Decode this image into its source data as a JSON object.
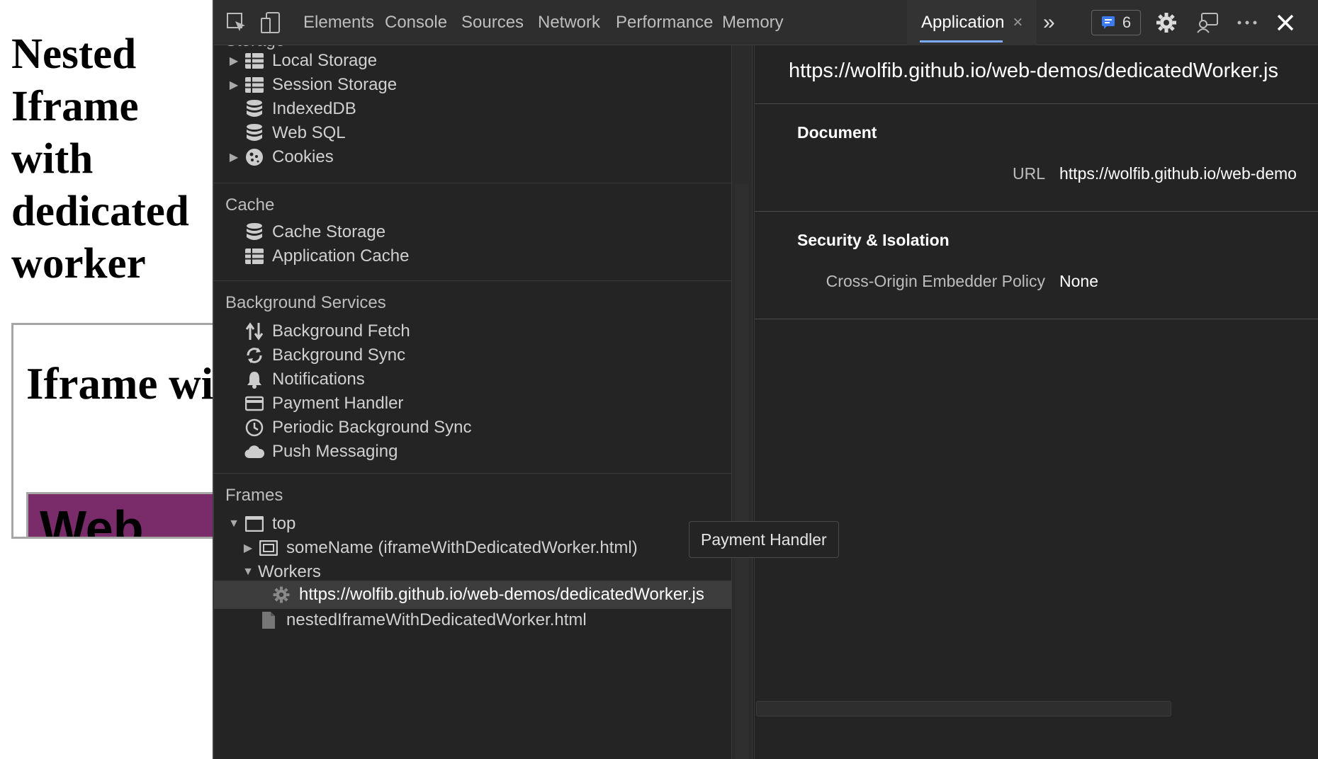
{
  "page": {
    "heading": "Nested Iframe with dedicated worker",
    "iframe_heading": "Iframe with dedicated",
    "inner_frame_text": "Web"
  },
  "toolbar": {
    "tabs": [
      "Elements",
      "Console",
      "Sources",
      "Network",
      "Performance",
      "Memory"
    ],
    "active_tab": "Application",
    "close_tab_glyph": "×",
    "more_tabs_glyph": "»",
    "issues_count": "6"
  },
  "sidebar": {
    "storage_items": [
      {
        "label": "Local Storage",
        "icon": "grid-icon",
        "expandable": true
      },
      {
        "label": "Session Storage",
        "icon": "grid-icon",
        "expandable": true
      },
      {
        "label": "IndexedDB",
        "icon": "database-icon",
        "expandable": false
      },
      {
        "label": "Web SQL",
        "icon": "database-icon",
        "expandable": false
      },
      {
        "label": "Cookies",
        "icon": "cookie-icon",
        "expandable": true
      }
    ],
    "cache_title": "Cache",
    "cache_items": [
      {
        "label": "Cache Storage",
        "icon": "database-icon"
      },
      {
        "label": "Application Cache",
        "icon": "grid-icon"
      }
    ],
    "background_title": "Background Services",
    "background_items": [
      {
        "label": "Background Fetch",
        "icon": "up-down-arrows-icon"
      },
      {
        "label": "Background Sync",
        "icon": "sync-icon"
      },
      {
        "label": "Notifications",
        "icon": "bell-icon"
      },
      {
        "label": "Payment Handler",
        "icon": "card-icon"
      },
      {
        "label": "Periodic Background Sync",
        "icon": "clock-icon"
      },
      {
        "label": "Push Messaging",
        "icon": "cloud-icon"
      }
    ],
    "frames_title": "Frames",
    "frames": {
      "top": "top",
      "child_frame": "someName (iframeWithDedicatedWorker.html)",
      "workers": "Workers",
      "worker_url": "https://wolfib.github.io/web-demos/dedicatedWorker.js",
      "document": "nestedIframeWithDedicatedWorker.html"
    }
  },
  "main": {
    "title_url": "https://wolfib.github.io/web-demos/dedicatedWorker.js",
    "document_title": "Document",
    "url_label": "URL",
    "url_value": "https://wolfib.github.io/web-demo",
    "security_title": "Security & Isolation",
    "coep_label": "Cross-Origin Embedder Policy",
    "coep_value": "None"
  },
  "tooltip": "Payment Handler",
  "colors": {
    "devtools_bg": "#242424",
    "toolbar_bg": "#2e2e2e",
    "accent": "#7cacf8",
    "iframe_inner_bg": "#7a2c6a"
  }
}
